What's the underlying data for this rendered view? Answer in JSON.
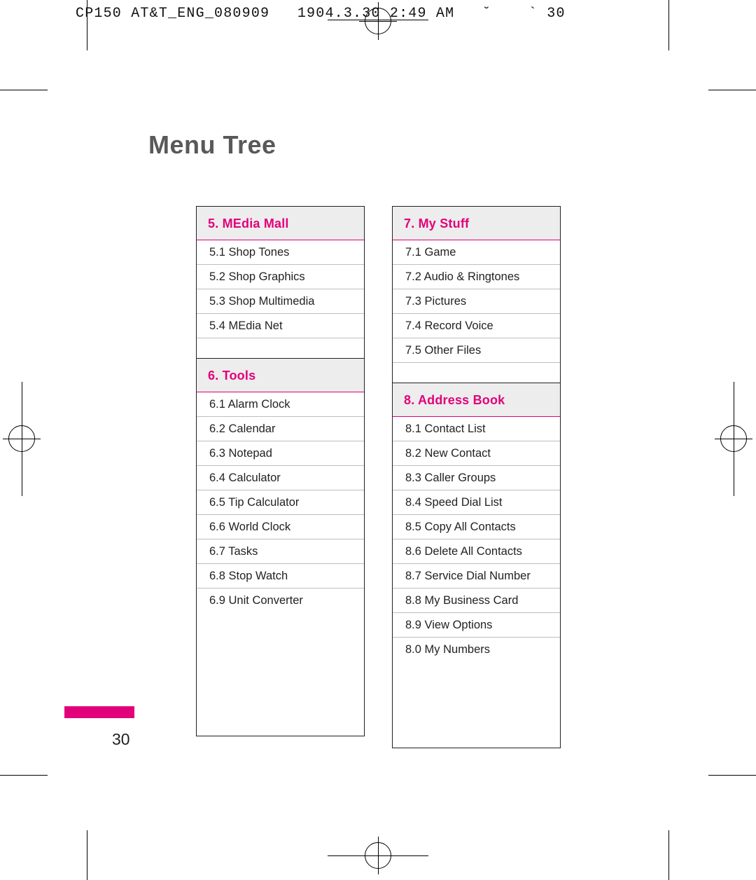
{
  "print": {
    "slug": "CP150 AT&T_ENG_080909   1904.3.30 2:49 AM   ˘    ` 30"
  },
  "document": {
    "title": "Menu Tree",
    "page_number": "30"
  },
  "columns": [
    {
      "cards": [
        {
          "header": "5. MEdia Mall",
          "items": [
            "5.1 Shop Tones",
            "5.2 Shop Graphics",
            "5.3 Shop Multimedia",
            "5.4 MEdia Net"
          ]
        },
        {
          "header": "6. Tools",
          "items": [
            "6.1 Alarm Clock",
            "6.2 Calendar",
            "6.3 Notepad",
            "6.4 Calculator",
            "6.5 Tip Calculator",
            "6.6 World Clock",
            "6.7 Tasks",
            "6.8 Stop Watch",
            "6.9 Unit Converter"
          ]
        }
      ]
    },
    {
      "cards": [
        {
          "header": "7. My Stuff",
          "items": [
            "7.1 Game",
            "7.2 Audio & Ringtones",
            "7.3 Pictures",
            "7.4 Record Voice",
            "7.5 Other Files"
          ]
        },
        {
          "header": "8. Address Book",
          "items": [
            "8.1 Contact List",
            "8.2 New Contact",
            "8.3 Caller Groups",
            "8.4 Speed Dial List",
            "8.5 Copy All Contacts",
            "8.6 Delete All Contacts",
            "8.7 Service Dial Number",
            "8.8 My Business Card",
            "8.9 View Options",
            "8.0 My Numbers"
          ]
        }
      ]
    }
  ],
  "colors": {
    "accent": "#e2007a",
    "header_bg": "#ededed",
    "title_gray": "#595959",
    "text": "#231f20",
    "rule": "#bcbec0"
  }
}
